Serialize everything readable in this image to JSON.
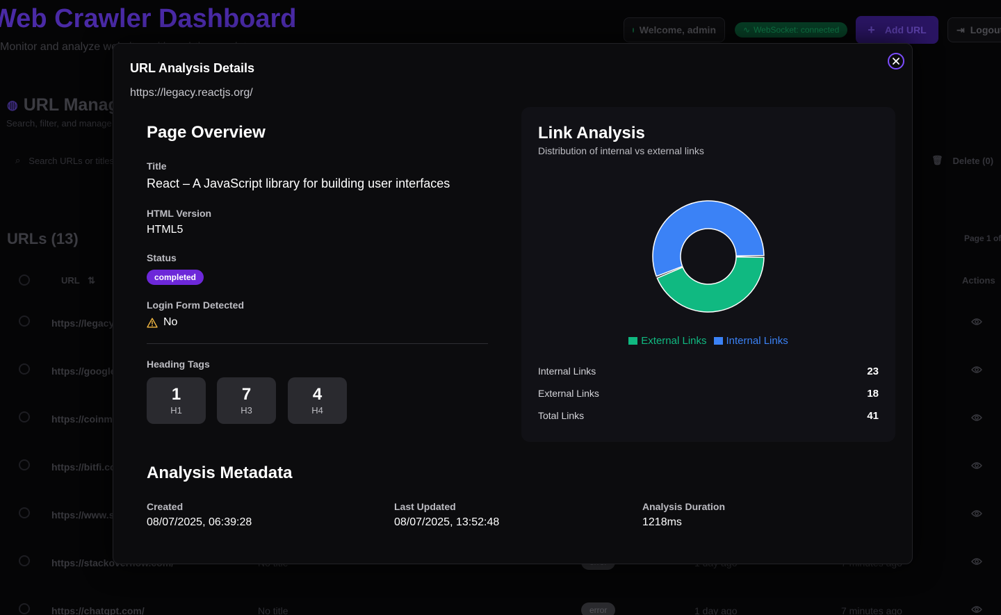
{
  "background": {
    "title": "Web Crawler Dashboard",
    "subtitle": "Monitor and analyze websites with real-time updates",
    "welcome": "Welcome, admin",
    "websocket": "WebSocket: connected",
    "add_url": "Add URL",
    "logout": "Logout",
    "section_title": "URL Management",
    "section_subtitle": "Search, filter, and manage",
    "search_placeholder": "Search URLs or titles",
    "delete_label": "Delete (0)",
    "urls_count": "URLs (13)",
    "page_indicator": "Page 1 of",
    "col_url": "URL",
    "col_actions": "Actions",
    "rows": [
      {
        "url": "https://legacy.reactjs.org/",
        "title": "",
        "status": "",
        "created": "",
        "updated": ""
      },
      {
        "url": "https://google.com/",
        "title": "",
        "status": "",
        "created": "",
        "updated": ""
      },
      {
        "url": "https://coinmarketcap.com/",
        "title": "",
        "status": "",
        "created": "",
        "updated": ""
      },
      {
        "url": "https://bitfi.com/",
        "title": "",
        "status": "",
        "created": "",
        "updated": ""
      },
      {
        "url": "https://www.s",
        "title": "",
        "status": "",
        "created": "",
        "updated": ""
      },
      {
        "url": "https://stackoverflow.com/",
        "title": "No title",
        "status": "error",
        "created": "1 day ago",
        "updated": "7 minutes ago"
      },
      {
        "url": "https://chatgpt.com/",
        "title": "No title",
        "status": "error",
        "created": "1 day ago",
        "updated": "7 minutes ago"
      }
    ]
  },
  "modal": {
    "title": "URL Analysis Details",
    "url": "https://legacy.reactjs.org/",
    "overview": {
      "heading": "Page Overview",
      "title_label": "Title",
      "title_value": "React – A JavaScript library for building user interfaces",
      "html_label": "HTML Version",
      "html_value": "HTML5",
      "status_label": "Status",
      "status_value": "completed",
      "login_label": "Login Form Detected",
      "login_value": "No",
      "headings_label": "Heading Tags",
      "headings": [
        {
          "count": "1",
          "tag": "H1"
        },
        {
          "count": "7",
          "tag": "H3"
        },
        {
          "count": "4",
          "tag": "H4"
        }
      ]
    },
    "link_analysis": {
      "heading": "Link Analysis",
      "subtitle": "Distribution of internal vs external links",
      "internal_label": "Internal Links",
      "internal_value": "23",
      "external_label": "External Links",
      "external_value": "18",
      "total_label": "Total Links",
      "total_value": "41"
    },
    "metadata": {
      "heading": "Analysis Metadata",
      "created_label": "Created",
      "created_value": "08/07/2025, 06:39:28",
      "updated_label": "Last Updated",
      "updated_value": "08/07/2025, 13:52:48",
      "duration_label": "Analysis Duration",
      "duration_value": "1218ms"
    }
  },
  "chart_data": {
    "type": "pie",
    "categories": [
      "External Links",
      "Internal Links"
    ],
    "values": [
      18,
      23
    ],
    "colors": [
      "#10b981",
      "#3b82f6"
    ],
    "legend": "bottom",
    "title": "Link Analysis"
  }
}
